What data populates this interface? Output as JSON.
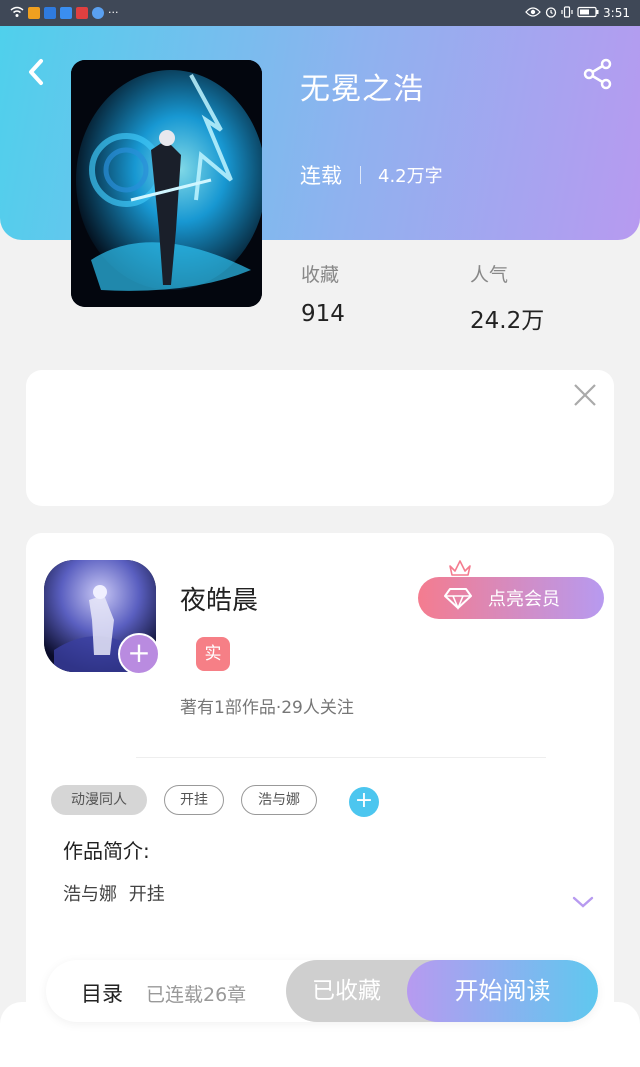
{
  "status_bar": {
    "time": "3:51"
  },
  "header": {
    "title": "无冕之浩",
    "status": "连载",
    "word_count": "4.2万字"
  },
  "stats": {
    "favorites_label": "收藏",
    "favorites_value": "914",
    "popularity_label": "人气",
    "popularity_value": "24.2万"
  },
  "author": {
    "name": "夜皓晨",
    "verified_badge": "实",
    "stats_text": "著有1部作品·29人关注",
    "vip_button_label": "点亮会员"
  },
  "tags": {
    "category": "动漫同人",
    "items": [
      "开挂",
      "浩与娜"
    ]
  },
  "intro": {
    "title": "作品简介:",
    "text": "浩与娜 开挂"
  },
  "bottom_bar": {
    "toc_label": "目录",
    "chapters_text": "已连载26章",
    "collected_label": "已收藏",
    "read_label": "开始阅读"
  },
  "colors": {
    "header_gradient_start": "#4fd0ec",
    "header_gradient_end": "#b79af0",
    "accent_blue": "#4cc6ef",
    "accent_purple": "#b98be0",
    "vip_pink": "#f47c8f"
  },
  "icons": {
    "back": "back-arrow-icon",
    "share": "share-icon",
    "close": "close-icon",
    "crown": "crown-icon",
    "diamond": "diamond-icon",
    "plus": "plus-icon",
    "chevron": "chevron-down-icon"
  }
}
